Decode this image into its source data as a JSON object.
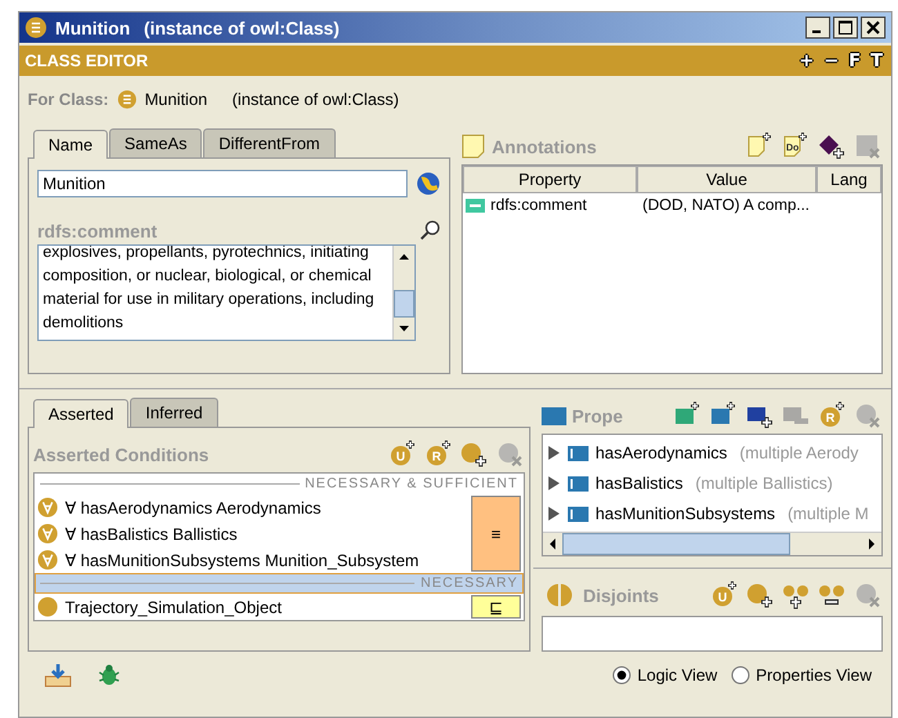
{
  "window": {
    "title": "Munition",
    "subtitle": "(instance of owl:Class)"
  },
  "editor": {
    "title": "CLASS EDITOR",
    "tools": [
      "+",
      "−",
      "F",
      "T"
    ]
  },
  "for_class": {
    "label": "For Class:",
    "name": "Munition",
    "type": "(instance of owl:Class)"
  },
  "name_tabs": [
    {
      "label": "Name",
      "selected": true
    },
    {
      "label": "SameAs",
      "selected": false
    },
    {
      "label": "DifferentFrom",
      "selected": false
    }
  ],
  "name_field": {
    "value": "Munition"
  },
  "comment": {
    "label": "rdfs:comment",
    "value": "explosives, propellants, pyrotechnics, initiating composition, or nuclear, biological, or chemical material for use in military operations, including demolitions"
  },
  "annotations": {
    "title": "Annotations",
    "toolbar": [
      {
        "kind": "note",
        "disabled": false
      },
      {
        "kind": "doc",
        "text": "Do",
        "disabled": false
      },
      {
        "kind": "diamond",
        "disabled": false
      },
      {
        "kind": "erase",
        "disabled": true
      }
    ],
    "columns": [
      "Property",
      "Value",
      "Lang"
    ],
    "rows": [
      {
        "property": "rdfs:comment",
        "value": "(DOD, NATO) A comp..."
      }
    ]
  },
  "condition_tabs": [
    {
      "label": "Asserted",
      "selected": true
    },
    {
      "label": "Inferred",
      "selected": false
    }
  ],
  "conditions": {
    "title": "Asserted Conditions",
    "toolbar": [
      {
        "kind": "letter",
        "text": "U",
        "disabled": false
      },
      {
        "kind": "letter",
        "text": "R",
        "disabled": false
      },
      {
        "kind": "join",
        "disabled": false
      },
      {
        "kind": "remove",
        "disabled": true
      }
    ],
    "groups": [
      {
        "header": "NECESSARY & SUFFICIENT",
        "kind": "equivalent",
        "symbol": "≡",
        "selected": false,
        "items": [
          {
            "kind": "restriction",
            "text": "∀ hasAerodynamics Aerodynamics"
          },
          {
            "kind": "restriction",
            "text": "∀ hasBalistics Ballistics"
          },
          {
            "kind": "restriction",
            "text": "∀ hasMunitionSubsystems Munition_Subsystem"
          }
        ]
      },
      {
        "header": "NECESSARY",
        "kind": "subclass",
        "symbol": "⊑",
        "selected": true,
        "items": [
          {
            "kind": "class",
            "text": "Trajectory_Simulation_Object"
          }
        ]
      }
    ]
  },
  "properties": {
    "title": "Prope",
    "toolbar": [
      {
        "kind": "square",
        "color": "#2fa878",
        "disabled": false
      },
      {
        "kind": "square",
        "color": "#2a78b0",
        "disabled": false
      },
      {
        "kind": "assign",
        "disabled": false
      },
      {
        "kind": "unassign",
        "disabled": true
      },
      {
        "kind": "letter",
        "text": "R",
        "disabled": false
      },
      {
        "kind": "remove",
        "disabled": true
      }
    ],
    "rows": [
      {
        "name": "hasAerodynamics",
        "range": "(multiple Aerody"
      },
      {
        "name": "hasBalistics",
        "range": "(multiple Ballistics)"
      },
      {
        "name": "hasMunitionSubsystems",
        "range": "(multiple M"
      }
    ]
  },
  "disjoints": {
    "title": "Disjoints",
    "toolbar": [
      {
        "kind": "letter",
        "text": "U",
        "disabled": false
      },
      {
        "kind": "join",
        "disabled": false
      },
      {
        "kind": "pairadd",
        "disabled": false
      },
      {
        "kind": "pairremove",
        "disabled": false
      },
      {
        "kind": "remove",
        "disabled": true
      }
    ]
  },
  "views": [
    {
      "label": "Logic View",
      "selected": true
    },
    {
      "label": "Properties View",
      "selected": false
    }
  ]
}
